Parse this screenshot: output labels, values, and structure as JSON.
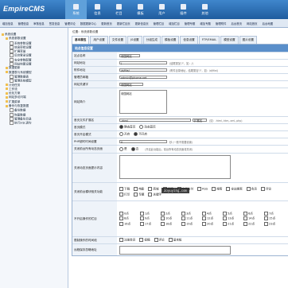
{
  "logo": {
    "main": "EmpireCMS",
    "suffix": "7.0"
  },
  "topnav": [
    {
      "label": "系统",
      "active": true
    },
    {
      "label": "信息",
      "active": false
    },
    {
      "label": "栏目",
      "active": false
    },
    {
      "label": "模板",
      "active": false
    },
    {
      "label": "用户",
      "active": false
    },
    {
      "label": "插件",
      "active": false
    },
    {
      "label": "其他",
      "active": false
    }
  ],
  "subnav": [
    "增加信息",
    "管理信息",
    "审核信息",
    "签发信息",
    "管理评论",
    "数据更新中心",
    "更新首页",
    "更新栏目页",
    "更新信息页",
    "管理栏目",
    "增加栏目",
    "管理专题",
    "增加专题",
    "管理附件",
    "后台首页",
    "网站首页",
    "后台地图"
  ],
  "sidebar": {
    "items": [
      {
        "label": "系统设置",
        "kind": "folder",
        "indent": 0
      },
      {
        "label": "系统参数设置",
        "kind": "folder",
        "indent": 1
      },
      {
        "label": "系统参数设置",
        "kind": "file",
        "indent": 2
      },
      {
        "label": "信息审批设置",
        "kind": "file",
        "indent": 2
      },
      {
        "label": "扩展变量",
        "kind": "file",
        "indent": 2
      },
      {
        "label": "后台登录设置",
        "kind": "file",
        "indent": 2
      },
      {
        "label": "安全参数配置",
        "kind": "file",
        "indent": 2
      },
      {
        "label": "网站地图设置",
        "kind": "file",
        "indent": 2
      },
      {
        "label": "数据更新",
        "kind": "folder",
        "indent": 1
      },
      {
        "label": "数据表与系统模型",
        "kind": "folder",
        "indent": 1
      },
      {
        "label": "管理数据表",
        "kind": "file",
        "indent": 2
      },
      {
        "label": "管理系统模型",
        "kind": "file",
        "indent": 2
      },
      {
        "label": "计划任务",
        "kind": "folder",
        "indent": 1
      },
      {
        "label": "工作流",
        "kind": "folder",
        "indent": 1
      },
      {
        "label": "优化方案",
        "kind": "folder",
        "indent": 1
      },
      {
        "label": "网站多访问端",
        "kind": "folder",
        "indent": 1
      },
      {
        "label": "扩展菜单",
        "kind": "folder",
        "indent": 1
      },
      {
        "label": "备份与恢复数据",
        "kind": "folder",
        "indent": 1
      },
      {
        "label": "备份数据",
        "kind": "file",
        "indent": 2
      },
      {
        "label": "恢复数据",
        "kind": "file",
        "indent": 2
      },
      {
        "label": "管理备份目录",
        "kind": "file",
        "indent": 2
      },
      {
        "label": "执行SQL语句",
        "kind": "file",
        "indent": 2
      }
    ]
  },
  "crumb": "位置：系统参数设置",
  "tabs": [
    {
      "label": "基本属性",
      "active": true
    },
    {
      "label": "用户设置",
      "active": false
    },
    {
      "label": "文件设置",
      "active": false
    },
    {
      "label": "JS设置",
      "active": false
    },
    {
      "label": "分组生成",
      "active": false
    },
    {
      "label": "模板设置",
      "active": false
    },
    {
      "label": "信息设置",
      "active": false
    },
    {
      "label": "FTP/EMAIL",
      "active": false
    },
    {
      "label": "模型设置",
      "active": false
    },
    {
      "label": "图片设置",
      "active": false
    }
  ],
  "table_head": "站点信息设置",
  "form": {
    "site_name": {
      "label": "站点名称",
      "value": "帝国网站"
    },
    "site_url": {
      "label": "网站地址",
      "value": "/",
      "hint": "(结尾需加\"/\"，如：/)"
    },
    "file_url": {
      "label": "附件地址",
      "value": "/d/file/",
      "hint": "(附件目录地址，结尾需加\"/\"，如：/d/file/)"
    },
    "admin_email": {
      "label": "管理员邮箱",
      "value": "admin@phome.net"
    },
    "keywords": {
      "label": "网站关键字",
      "value": "帝国网站"
    },
    "intro": {
      "label": "网站简介",
      "value": "帝国网站"
    },
    "index_ext": {
      "label": "首页文件扩展名",
      "value": ".html",
      "select": "扩展名",
      "hint": "(如：.html,.htm,.xml,.php)"
    },
    "index_mode": {
      "label": "首页模式",
      "options": [
        "静态首页",
        "动态首页"
      ],
      "selected": 0
    },
    "index_open": {
      "label": "首页开启模式",
      "options": [
        "开启",
        "不开启"
      ],
      "selected": 1
    },
    "php_timeout": {
      "label": "PHP超时时间设置",
      "value": "0",
      "hint": "秒 (一般不需要设置)"
    },
    "close_site": {
      "label": "关闭前台所有动态页面",
      "options": [
        "是",
        "否"
      ],
      "selected": 1,
      "hint": "(开启此功能后，前台所有动态页面将关闭)"
    },
    "close_msg": {
      "label": "关闭动态页面提示内容",
      "value": ""
    },
    "close_funcs": {
      "label": "关闭前台模块相关功能",
      "options": [
        "下载",
        "电影",
        "商城",
        "投稿",
        "在线支付",
        "RSS",
        "搜索",
        "全站搜索",
        "会员",
        "评论",
        "打印",
        "专题",
        "关键字"
      ]
    },
    "close_columns": {
      "label": "不开启操作的栏目",
      "options": [
        "0点",
        "1点",
        "2点",
        "3点",
        "4点",
        "5点",
        "6点",
        "7点",
        "8点",
        "9点",
        "10点",
        "11点",
        "12点",
        "13点",
        "14点",
        "15点",
        "16点",
        "17点",
        "18点",
        "19点",
        "20点",
        "21点",
        "22点",
        "23点"
      ]
    },
    "close_ops": {
      "label": "限制操作的时间段",
      "options": [
        "注册会员",
        "投稿",
        "评论",
        "留言板"
      ]
    },
    "remote_delay": {
      "label": "远程保存忽略地址",
      "value": ""
    }
  },
  "buttons": {
    "select_all": "全选"
  },
  "watermark": "aoyuying.com"
}
